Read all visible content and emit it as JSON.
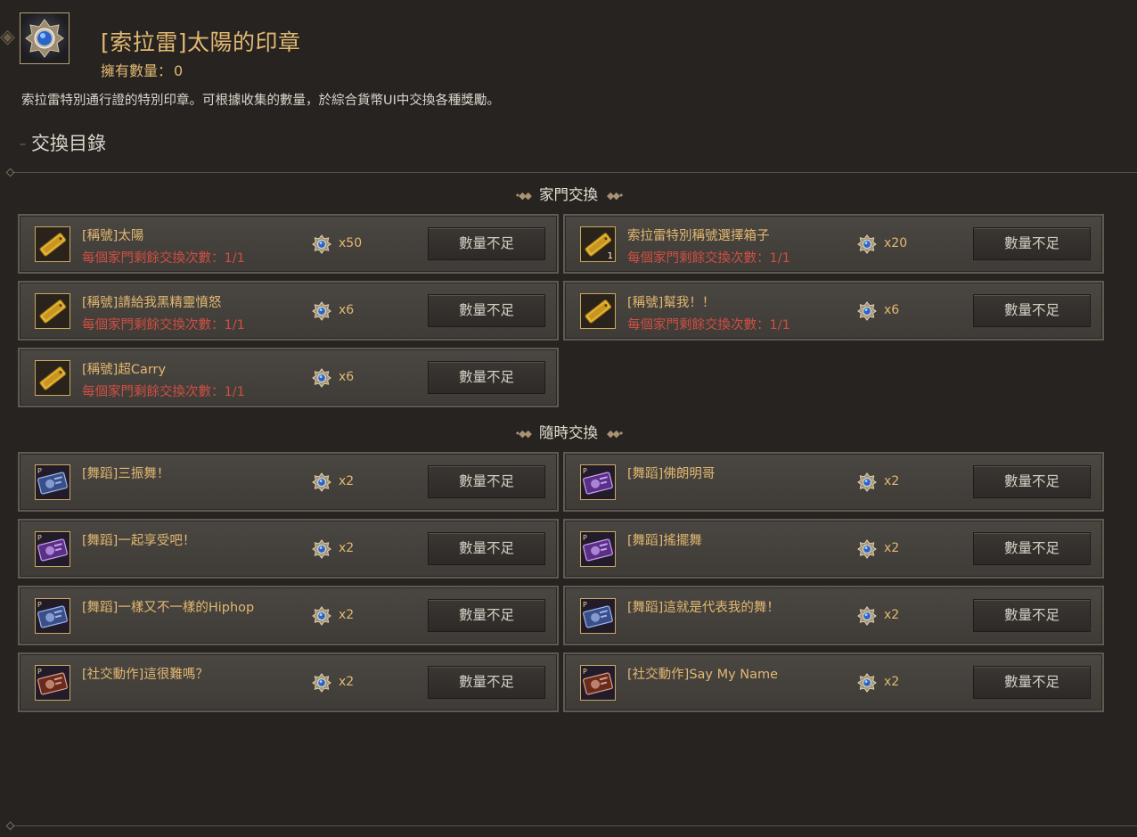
{
  "item": {
    "title": "[索拉雷]太陽的印章",
    "owned_label": "擁有數量：",
    "owned_value": "0",
    "description": "索拉雷特別通行證的特別印章。可根據收集的數量，於綜合貨幣UI中交換各種獎勵。"
  },
  "section_title": "交換目錄",
  "groups": [
    {
      "title": "家門交換",
      "entries": [
        {
          "name": "[稱號]太陽",
          "limit": "每個家門剩餘交換次數：1/1",
          "cost": "x50",
          "button": "數量不足",
          "icon": "title-ticket-icon"
        },
        {
          "name": "索拉雷特別稱號選擇箱子",
          "limit": "每個家門剩餘交換次數：1/1",
          "cost": "x20",
          "button": "數量不足",
          "icon": "title-ticket-icon",
          "qty": "1"
        },
        {
          "name": "[稱號]請給我黑精靈憤怒",
          "limit": "每個家門剩餘交換次數：1/1",
          "cost": "x6",
          "button": "數量不足",
          "icon": "title-ticket-icon"
        },
        {
          "name": "[稱號]幫我！！",
          "limit": "每個家門剩餘交換次數：1/1",
          "cost": "x6",
          "button": "數量不足",
          "icon": "title-ticket-icon"
        },
        {
          "name": "[稱號]超Carry",
          "limit": "每個家門剩餘交換次數：1/1",
          "cost": "x6",
          "button": "數量不足",
          "icon": "title-ticket-icon"
        }
      ]
    },
    {
      "title": "隨時交換",
      "entries": [
        {
          "name": "[舞蹈]三振舞！",
          "cost": "x2",
          "button": "數量不足",
          "icon": "dance-card-blue-icon"
        },
        {
          "name": "[舞蹈]佛朗明哥",
          "cost": "x2",
          "button": "數量不足",
          "icon": "dance-card-purple-icon"
        },
        {
          "name": "[舞蹈]一起享受吧！",
          "cost": "x2",
          "button": "數量不足",
          "icon": "dance-card-purple-icon"
        },
        {
          "name": "[舞蹈]搖擺舞",
          "cost": "x2",
          "button": "數量不足",
          "icon": "dance-card-purple-icon"
        },
        {
          "name": "[舞蹈]一樣又不一樣的Hiphop",
          "cost": "x2",
          "button": "數量不足",
          "icon": "dance-card-blue-icon"
        },
        {
          "name": "[舞蹈]這就是代表我的舞！",
          "cost": "x2",
          "button": "數量不足",
          "icon": "dance-card-blue-icon"
        },
        {
          "name": "[社交動作]這很難嗎？",
          "cost": "x2",
          "button": "數量不足",
          "icon": "social-card-red-icon"
        },
        {
          "name": "[社交動作]Say My Name",
          "cost": "x2",
          "button": "數量不足",
          "icon": "social-card-red-icon"
        }
      ]
    }
  ],
  "colors": {
    "background": "#262321",
    "gold_text": "#e2b871",
    "limit_red": "#cf4f43",
    "card_bg": "#46423d",
    "card_border": "#5f5951"
  }
}
